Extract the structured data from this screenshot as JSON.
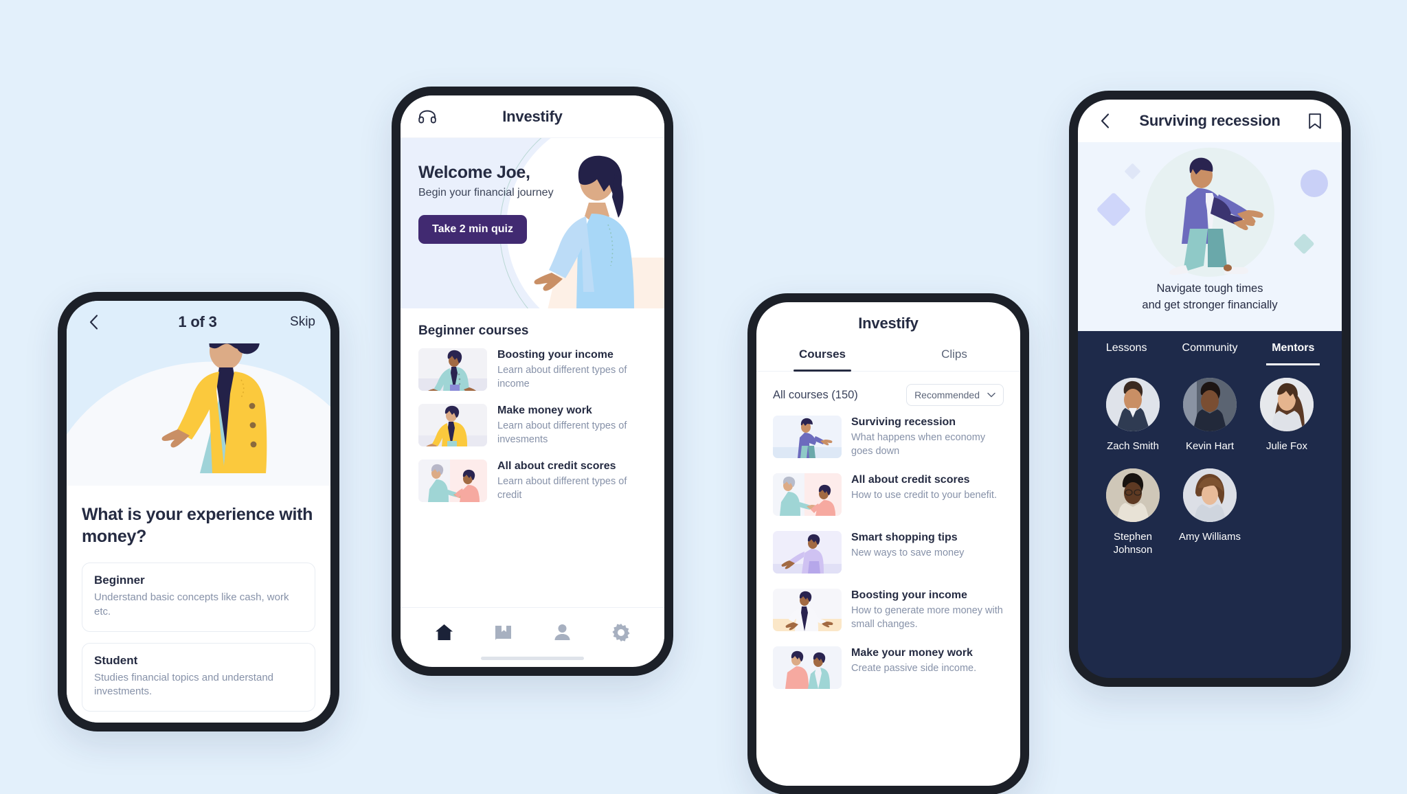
{
  "canvas": {
    "background": "#e3f0fb"
  },
  "brand": {
    "name": "Investify",
    "purple": "#412a71",
    "navy": "#1e2a4a",
    "ink": "#252b42",
    "muted": "#8691a8"
  },
  "onboarding": {
    "back_icon": "chevron-left-icon",
    "step_label": "1 of 3",
    "skip_label": "Skip",
    "question": "What is your experience with money?",
    "options": [
      {
        "title": "Beginner",
        "desc": "Understand basic concepts like cash, work etc."
      },
      {
        "title": "Student",
        "desc": "Studies financial topics and understand investments."
      }
    ]
  },
  "home": {
    "headphones_icon": "headphones-icon",
    "title": "Investify",
    "hero": {
      "greeting": "Welcome Joe,",
      "subtitle": "Begin your financial journey",
      "cta": "Take 2 min quiz"
    },
    "section_title": "Beginner courses",
    "courses": [
      {
        "name": "Boosting your income",
        "desc": "Learn about different types of income"
      },
      {
        "name": "Make money work",
        "desc": "Learn about different types of invesments"
      },
      {
        "name": "All about credit scores",
        "desc": "Learn about different types of credit"
      }
    ],
    "tabbar": [
      {
        "icon": "home-icon",
        "active": true
      },
      {
        "icon": "bookmark-book-icon",
        "active": false
      },
      {
        "icon": "person-icon",
        "active": false
      },
      {
        "icon": "gear-icon",
        "active": false
      }
    ]
  },
  "courses_screen": {
    "title": "Investify",
    "tabs": [
      {
        "label": "Courses",
        "active": true
      },
      {
        "label": "Clips",
        "active": false
      }
    ],
    "filter_label": "All courses (150)",
    "sort_value": "Recommended",
    "sort_icon": "chevron-down-icon",
    "list": [
      {
        "name": "Surviving recession",
        "desc": "What happens when economy goes down"
      },
      {
        "name": "All about credit scores",
        "desc": "How to use credit to your benefit."
      },
      {
        "name": "Smart shopping tips",
        "desc": "New ways to save money"
      },
      {
        "name": "Boosting your income",
        "desc": "How to generate more money with small changes."
      },
      {
        "name": "Make your money work",
        "desc": "Create passive side income."
      }
    ]
  },
  "course_detail": {
    "back_icon": "chevron-left-icon",
    "title": "Surviving recession",
    "bookmark_icon": "bookmark-icon",
    "caption_line1": "Navigate tough times",
    "caption_line2": "and get stronger financially",
    "tabs": [
      {
        "label": "Lessons",
        "active": false
      },
      {
        "label": "Community",
        "active": false
      },
      {
        "label": "Mentors",
        "active": true
      }
    ],
    "mentors": [
      {
        "name": "Zach Smith"
      },
      {
        "name": "Kevin Hart"
      },
      {
        "name": "Julie Fox"
      },
      {
        "name": "Stephen Johnson"
      },
      {
        "name": "Amy Williams"
      }
    ]
  }
}
